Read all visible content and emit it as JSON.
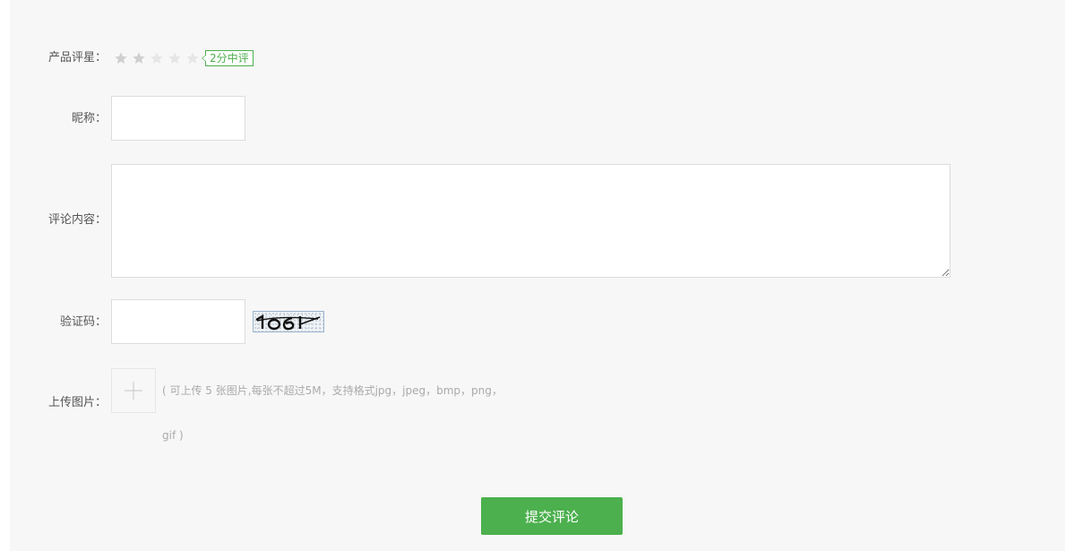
{
  "form": {
    "rating": {
      "label": "产品评星：",
      "stars_total": 5,
      "stars_filled": 2,
      "tag": "2分中评",
      "filled_color": "#cfcfcf",
      "empty_color": "#e6e6e6",
      "tag_color": "#4cae4c"
    },
    "nickname": {
      "label": "昵称：",
      "value": ""
    },
    "content": {
      "label": "评论内容：",
      "value": ""
    },
    "captcha": {
      "label": "验证码：",
      "value": "",
      "image_text": "1o61"
    },
    "upload": {
      "label": "上传图片：",
      "hint_line1": "( 可上传 5 张图片,每张不超过5M，支持格式jpg，jpeg，bmp，png，",
      "hint_line2": "gif )"
    },
    "submit_label": "提交评论",
    "accent_color": "#4cb04e"
  }
}
